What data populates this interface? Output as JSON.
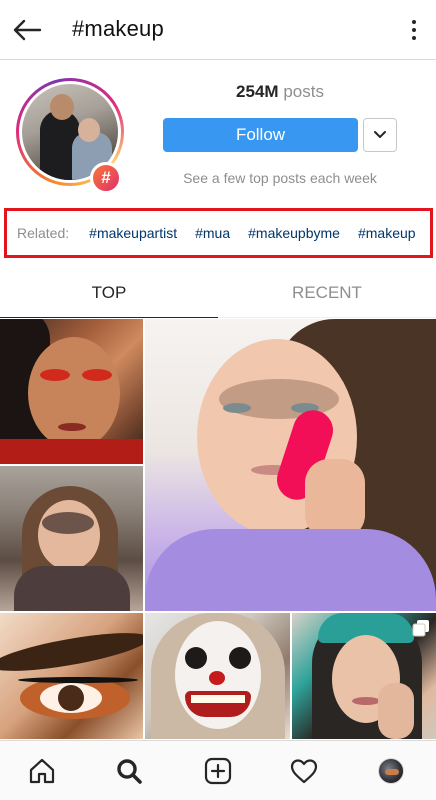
{
  "header": {
    "title": "#makeup",
    "back_icon": "arrow-left-icon",
    "more_icon": "more-vertical-icon"
  },
  "profile": {
    "hash_symbol": "#",
    "posts_count": "254M",
    "posts_label": "posts",
    "follow_label": "Follow",
    "dropdown_icon": "chevron-down-icon",
    "hint": "See a few top posts each week"
  },
  "related": {
    "label": "Related:",
    "tags": [
      "#makeupartist",
      "#mua",
      "#makeupbyme",
      "#makeup"
    ]
  },
  "tabs": {
    "top": "TOP",
    "recent": "RECENT",
    "active": "TOP"
  },
  "grid": {
    "posts": [
      {
        "name": "post-red-eyeshadow"
      },
      {
        "name": "post-child-facepaint"
      },
      {
        "name": "post-sponge-application"
      },
      {
        "name": "post-eyeliner-closeup"
      },
      {
        "name": "post-clown-makeup"
      },
      {
        "name": "post-teal-hair",
        "multi": true
      }
    ]
  },
  "bottom_nav": {
    "items": [
      "home-icon",
      "search-icon",
      "add-post-icon",
      "heart-icon",
      "profile-avatar"
    ],
    "active": "search-icon"
  },
  "colors": {
    "follow_blue": "#3897f0",
    "related_outline": "#e2141e",
    "hashtag_link": "#003569"
  }
}
